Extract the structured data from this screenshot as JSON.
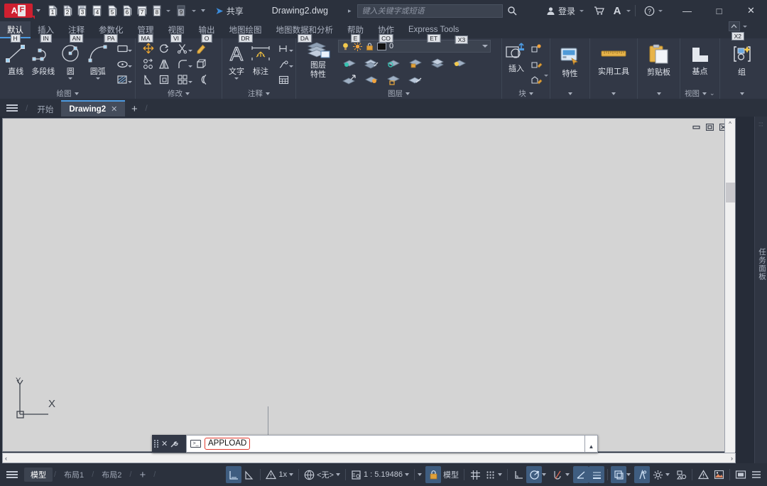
{
  "titlebar": {
    "brand_top": "A",
    "brand_bottom": "F",
    "quick_access": [
      {
        "name": "new",
        "num": "1"
      },
      {
        "name": "open",
        "num": "2"
      },
      {
        "name": "save",
        "num": "3"
      },
      {
        "name": "saveas",
        "num": "4"
      },
      {
        "name": "plot",
        "num": "5"
      },
      {
        "name": "undo",
        "num": "6"
      },
      {
        "name": "redo",
        "num": "7"
      },
      {
        "name": "print-preview",
        "num": "8"
      },
      {
        "name": "customize",
        "num": "9"
      }
    ],
    "share_label": "共享",
    "document_title": "Drawing2.dwg",
    "search_placeholder": "键入关键字或短语",
    "login_label": "登录",
    "minimize": "—",
    "maximize": "□",
    "close": "✕"
  },
  "ribbon_tabs": [
    {
      "label": "默认",
      "key": "H",
      "active": true
    },
    {
      "label": "插入",
      "key": "IN",
      "active": false
    },
    {
      "label": "注释",
      "key": "AN",
      "active": false
    },
    {
      "label": "参数化",
      "key": "PA",
      "active": false
    },
    {
      "label": "管理",
      "key": "MA",
      "active": false
    },
    {
      "label": "视图",
      "key": "VI",
      "active": false
    },
    {
      "label": "输出",
      "key": "O",
      "active": false
    },
    {
      "label": "地图绘图",
      "key": "DR",
      "active": false
    },
    {
      "label": "地图数据和分析",
      "key": "DA",
      "active": false
    },
    {
      "label": "帮助",
      "key": "E",
      "active": false
    },
    {
      "label": "协作",
      "key": "CO",
      "active": false
    },
    {
      "label": "Express Tools",
      "key": "ET",
      "active": false
    }
  ],
  "ribbon_tabs_extra_keys": [
    "X2",
    "X3"
  ],
  "panels": {
    "draw": {
      "title": "绘图",
      "big_buttons": [
        {
          "label": "直线",
          "icon": "line-icon",
          "dropdown": false
        },
        {
          "label": "多段线",
          "icon": "polyline-icon",
          "dropdown": false
        },
        {
          "label": "圆",
          "icon": "circle-icon",
          "dropdown": true
        },
        {
          "label": "圆弧",
          "icon": "arc-icon",
          "dropdown": true
        }
      ],
      "small_buttons": [
        {
          "name": "rectangle-icon",
          "dropdown": true
        },
        {
          "name": "ellipse-icon",
          "dropdown": true
        },
        {
          "name": "hatch-icon",
          "dropdown": true
        }
      ]
    },
    "modify": {
      "title": "修改",
      "small_buttons": [
        {
          "name": "move-icon",
          "dropdown": false
        },
        {
          "name": "rotate-icon",
          "dropdown": false
        },
        {
          "name": "trim-icon",
          "dropdown": true
        },
        {
          "name": "erase-icon",
          "dropdown": false
        },
        {
          "name": "copy-icon",
          "dropdown": false
        },
        {
          "name": "mirror-icon",
          "dropdown": false
        },
        {
          "name": "fillet-icon",
          "dropdown": true
        },
        {
          "name": "array-icon",
          "dropdown": false
        },
        {
          "name": "stretch-icon",
          "dropdown": false
        },
        {
          "name": "scale-icon",
          "dropdown": false
        },
        {
          "name": "offset-icon",
          "dropdown": true
        },
        {
          "name": "join-icon",
          "dropdown": false
        }
      ]
    },
    "annotation": {
      "title": "注释",
      "big_buttons": [
        {
          "label": "文字",
          "icon": "text-icon",
          "dropdown": true
        },
        {
          "label": "标注",
          "icon": "dimension-icon",
          "dropdown": false
        }
      ],
      "small_buttons": [
        {
          "name": "dim-style-icon",
          "dropdown": true
        },
        {
          "name": "leader-icon",
          "dropdown": true
        },
        {
          "name": "table-icon",
          "dropdown": false
        }
      ]
    },
    "layers": {
      "title": "图层",
      "big_button": {
        "label_line1": "图层",
        "label_line2": "特性",
        "icon": "layer-properties-icon"
      },
      "layer_name": "0",
      "layer_color": "#000000",
      "row1": [
        "layer-on-icon",
        "layer-thaw-icon",
        "layer-freeze-icon",
        "layer-lock-icon",
        "layer-isolate-icon"
      ],
      "row2": [
        "layer-off-icon",
        "layer-match-icon",
        "layer-unisolate-icon",
        "layer-unlock-icon",
        "layer-previous-icon"
      ]
    },
    "block": {
      "title": "块",
      "big_button": {
        "label": "插入",
        "icon": "insert-block-icon",
        "dropdown": true
      },
      "small_buttons": [
        "create-block-icon",
        "edit-block-icon",
        "define-attribute-icon"
      ]
    },
    "properties": {
      "title": "特性",
      "label": "特性",
      "icon": "properties-icon"
    },
    "utilities": {
      "title": "实用工具",
      "label": "实用工具",
      "icon": "measure-icon"
    },
    "clipboard": {
      "title": "剪贴板",
      "label": "剪贴板",
      "icon": "clipboard-icon"
    },
    "view": {
      "title": "视图",
      "label": "基点",
      "icon": "basepoint-icon"
    },
    "group": {
      "title": "",
      "label": "组",
      "icon": "group-icon"
    }
  },
  "doctabs": {
    "menu_icon": "hamburger-icon",
    "start_tab": "开始",
    "tabs": [
      {
        "label": "Drawing2",
        "close": "✕",
        "active": true
      }
    ],
    "new_tab": "+"
  },
  "canvas": {
    "viewport_controls": [
      "minimize-icon",
      "restore-icon",
      "close-viewport-icon"
    ],
    "ucs_x": "X",
    "ucs_y": "Y",
    "scroll_left": "‹",
    "scroll_right": "›",
    "scroll_up": "^"
  },
  "taskpanel": {
    "label": "任务面板"
  },
  "command_line": {
    "close_icon": "✕",
    "settings_icon": "wrench-icon",
    "prompt_icon": "prompt-icon",
    "value": "APPLOAD",
    "expand_icon": "▲"
  },
  "statusbar": {
    "menu_icon": "hamburger-icon",
    "layout_tabs": [
      {
        "label": "模型",
        "active": true
      },
      {
        "label": "布局1",
        "active": false
      },
      {
        "label": "布局2",
        "active": false
      }
    ],
    "add_layout": "+",
    "right_items": [
      {
        "name": "model-space-icon",
        "label": "",
        "on": true
      },
      {
        "name": "annotation-visibility-icon",
        "label": "",
        "on": false
      },
      {
        "name": "annotation-scale-warning-icon",
        "label": "1x",
        "on": false,
        "caret": true
      },
      {
        "name": "workspace-icon",
        "label": "<无>",
        "on": false,
        "caret": true
      },
      {
        "name": "annotation-scale-icon",
        "label": "1 : 5.19486",
        "on": false,
        "caret": true
      },
      {
        "name": "lock-icon",
        "label": "",
        "on": true,
        "caret_before": true
      },
      {
        "name": "model-label",
        "label": "模型",
        "on": false
      },
      {
        "name": "grid-icon",
        "label": "",
        "on": false
      },
      {
        "name": "snap-icon",
        "label": "",
        "on": false,
        "caret": true
      },
      {
        "name": "ortho-icon",
        "label": "",
        "on": false
      },
      {
        "name": "polar-tracking-icon",
        "label": "",
        "on": true,
        "caret": true
      },
      {
        "name": "object-snap-icon",
        "label": "",
        "on": false,
        "caret": true
      },
      {
        "name": "otrack-icon",
        "label": "",
        "on": true
      },
      {
        "name": "lineweight-icon",
        "label": "",
        "on": true
      },
      {
        "name": "transparency-icon",
        "label": "",
        "on": true,
        "caret": true
      },
      {
        "name": "selection-cycling-icon",
        "label": "",
        "on": true
      },
      {
        "name": "settings-gear-icon",
        "label": "",
        "on": false,
        "caret": true
      },
      {
        "name": "isolate-objects-icon",
        "label": "",
        "on": false
      },
      {
        "name": "hardware-accel-icon",
        "label": "",
        "on": false
      },
      {
        "name": "clean-screen-icon",
        "label": "",
        "on": false
      },
      {
        "name": "fullscreen-icon",
        "label": "",
        "on": false
      },
      {
        "name": "customization-icon",
        "label": "",
        "on": false
      }
    ]
  }
}
